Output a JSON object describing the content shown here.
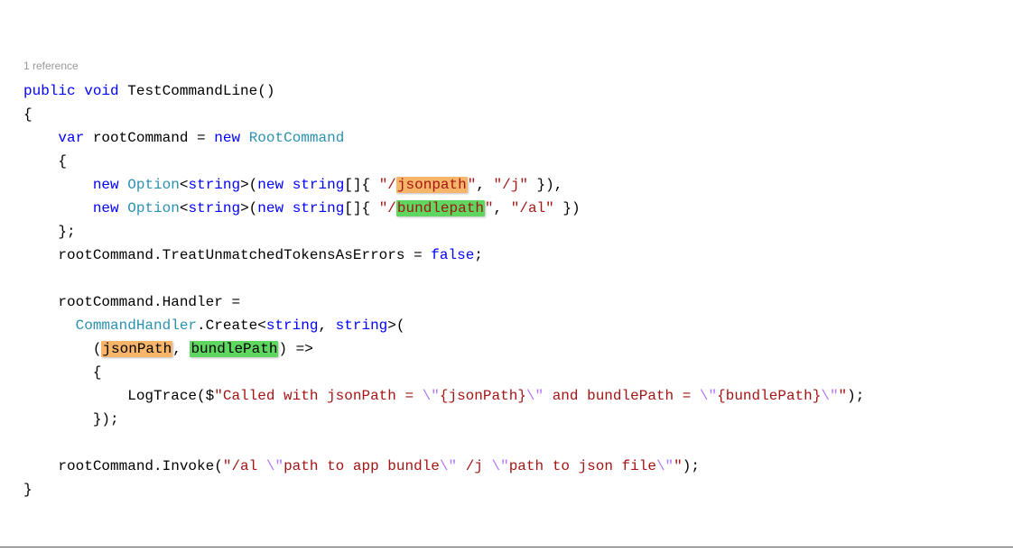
{
  "codelens": "1 reference",
  "line1": {
    "public": "public",
    "void": "void",
    "method": "TestCommandLine",
    "paren": "()"
  },
  "line2": {
    "brace": "{"
  },
  "line3": {
    "var": "var",
    "name": "rootCommand",
    "eq": " = ",
    "new": "new",
    "type": "RootCommand"
  },
  "line4": {
    "brace": "{"
  },
  "line5": {
    "new": "new",
    "option": "Option",
    "string": "string",
    "newkw": "new",
    "string2": "string",
    "open": "[]{ ",
    "q1": "\"/",
    "hl": "jsonpath",
    "q2": "\"",
    "comma": ", ",
    "q3": "\"/j\"",
    "close": " }),"
  },
  "line6": {
    "new": "new",
    "option": "Option",
    "string": "string",
    "newkw": "new",
    "string2": "string",
    "open": "[]{ ",
    "q1": "\"/",
    "hl": "bundlepath",
    "q2": "\"",
    "comma": ", ",
    "q3": "\"/al\"",
    "close": " })"
  },
  "line7": {
    "brace": "};"
  },
  "line8": {
    "pre": "rootCommand.TreatUnmatchedTokensAsErrors = ",
    "false": "false",
    "semi": ";"
  },
  "line9": {
    "txt": "rootCommand.Handler ="
  },
  "line10": {
    "type": "CommandHandler",
    "dot": ".Create<",
    "s1": "string",
    "comma": ", ",
    "s2": "string",
    "close": ">("
  },
  "line11": {
    "open": "(",
    "p1": "jsonPath",
    "comma": ", ",
    "p2": "bundlePath",
    "close": ") =>"
  },
  "line12": {
    "brace": "{"
  },
  "line13": {
    "call": "LogTrace($",
    "s1": "\"Called with jsonPath = ",
    "e1": "\\\"",
    "s2": "{jsonPath}",
    "e2": "\\\"",
    "s3": " and bundlePath = ",
    "e3": "\\\"",
    "s4": "{bundlePath}",
    "e4": "\\\"",
    "s5": "\"",
    "end": ");"
  },
  "line14": {
    "brace": "});"
  },
  "line15": {
    "pre": "rootCommand.Invoke(",
    "s1": "\"/al ",
    "e1": "\\\"",
    "s2": "path to app bundle",
    "e2": "\\\"",
    "s3": " /j ",
    "e3": "\\\"",
    "s4": "path to json file",
    "e4": "\\\"",
    "s5": "\"",
    "end": ");"
  },
  "line16": {
    "brace": "}"
  }
}
